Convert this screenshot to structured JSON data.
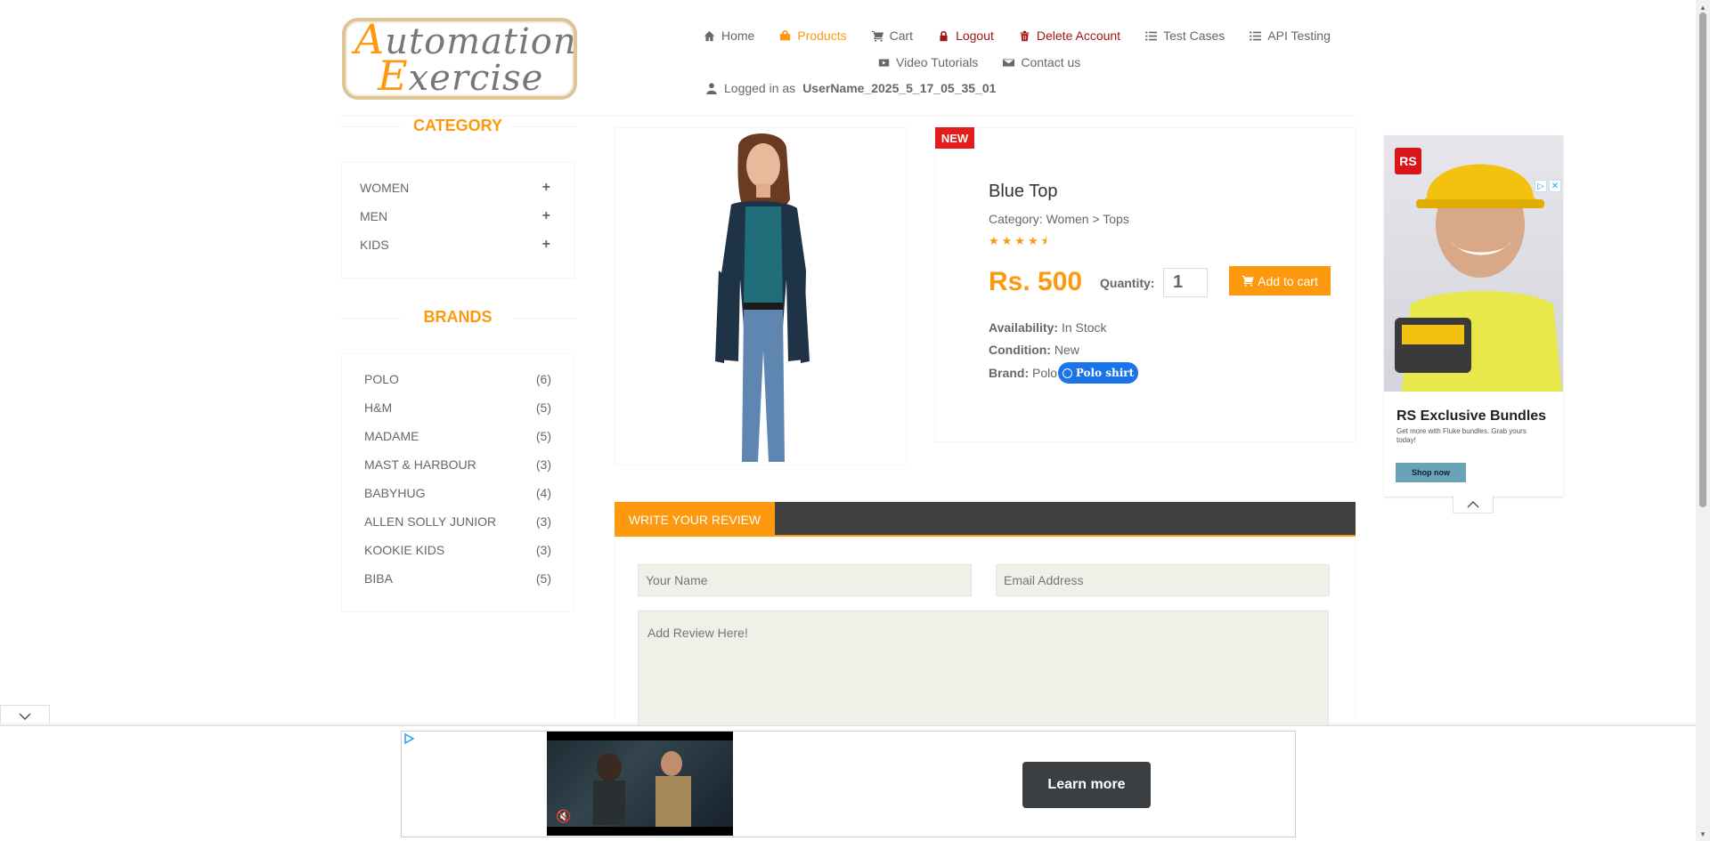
{
  "logo": {
    "line1_cap": "A",
    "line1_rest": "utomation",
    "line2_cap": "E",
    "line2_rest": "xercise"
  },
  "nav": {
    "items": [
      {
        "label": "Home",
        "icon": "home-icon"
      },
      {
        "label": "Products",
        "icon": "shopping-bag-icon"
      },
      {
        "label": "Cart",
        "icon": "cart-icon"
      },
      {
        "label": "Logout",
        "icon": "lock-icon"
      },
      {
        "label": "Delete Account",
        "icon": "trash-icon"
      },
      {
        "label": "Test Cases",
        "icon": "list-icon"
      },
      {
        "label": "API Testing",
        "icon": "list-icon"
      },
      {
        "label": "Video Tutorials",
        "icon": "youtube-icon"
      },
      {
        "label": "Contact us",
        "icon": "envelope-icon"
      }
    ],
    "logged_in_prefix": "Logged in as",
    "username": "UserName_2025_5_17_05_35_01"
  },
  "sidebar": {
    "category_title": "CATEGORY",
    "categories": [
      "WOMEN",
      "MEN",
      "KIDS"
    ],
    "brands_title": "BRANDS",
    "brands": [
      {
        "name": "POLO",
        "count": "(6)"
      },
      {
        "name": "H&M",
        "count": "(5)"
      },
      {
        "name": "MADAME",
        "count": "(5)"
      },
      {
        "name": "MAST & HARBOUR",
        "count": "(3)"
      },
      {
        "name": "BABYHUG",
        "count": "(4)"
      },
      {
        "name": "ALLEN SOLLY JUNIOR",
        "count": "(3)"
      },
      {
        "name": "KOOKIE KIDS",
        "count": "(3)"
      },
      {
        "name": "BIBA",
        "count": "(5)"
      }
    ]
  },
  "product": {
    "badge": "NEW",
    "name": "Blue Top",
    "category": "Category: Women > Tops",
    "rating": 4.5,
    "price": "Rs. 500",
    "quantity_label": "Quantity:",
    "quantity_value": "1",
    "add_to_cart": "Add to cart",
    "availability_label": "Availability:",
    "availability": "In Stock",
    "condition_label": "Condition:",
    "condition": "New",
    "brand_label": "Brand:",
    "brand": "Polo",
    "chip": "Polo shirt"
  },
  "review": {
    "tab": "WRITE YOUR REVIEW",
    "name_placeholder": "Your Name",
    "email_placeholder": "Email Address",
    "review_placeholder": "Add Review Here!"
  },
  "ad_right": {
    "brand": "RS",
    "title": "RS Exclusive Bundles",
    "subtitle": "Get more with Fluke bundles. Grab yours today!",
    "cta": "Shop now"
  },
  "ad_bottom": {
    "cta": "Learn more"
  },
  "colors": {
    "accent": "#fe980f",
    "danger": "#e61b1b",
    "chip": "#1a73e8",
    "review_bar": "#40403e"
  }
}
